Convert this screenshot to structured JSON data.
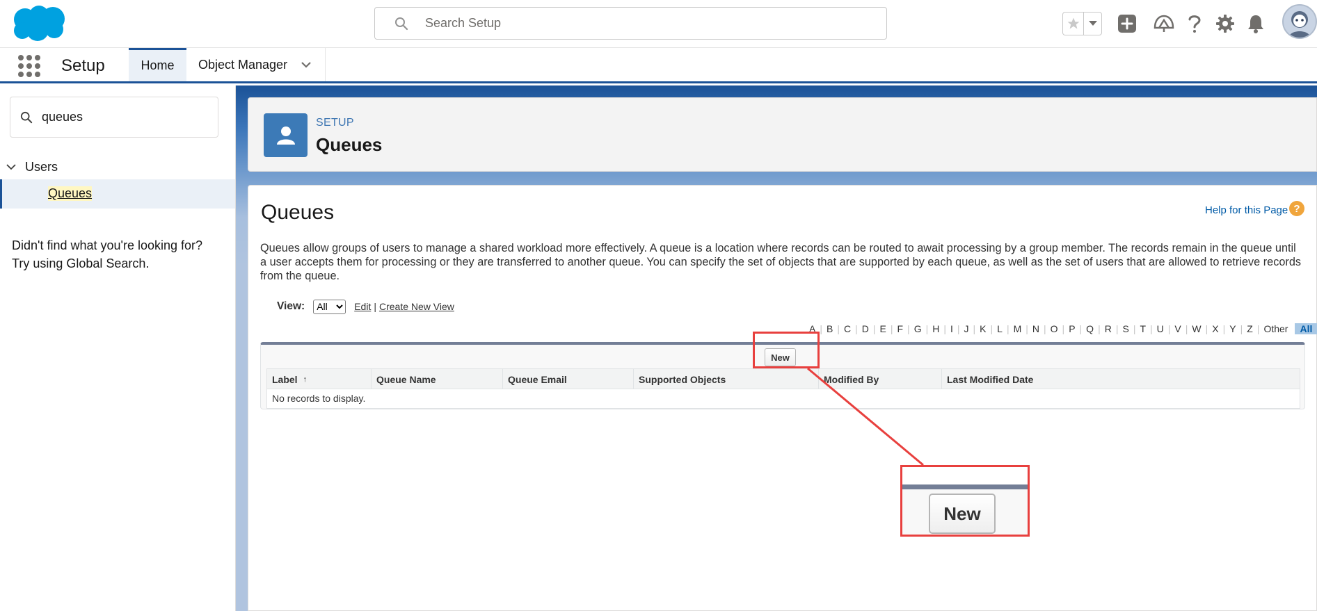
{
  "header": {
    "search_placeholder": "Search Setup",
    "icons": [
      "salesforce-cloud-logo",
      "search-icon",
      "star-icon",
      "chevron-down-icon",
      "add-icon",
      "trailhead-icon",
      "help-icon",
      "gear-icon",
      "bell-icon",
      "avatar"
    ]
  },
  "context_bar": {
    "app_name": "Setup",
    "tabs": [
      {
        "label": "Home",
        "active": true
      },
      {
        "label": "Object Manager",
        "active": false
      }
    ]
  },
  "sidebar": {
    "quickfind_value": "queues",
    "tree": {
      "group_label": "Users",
      "item_label": "Queues"
    },
    "not_found": {
      "line1": "Didn't find what you're looking for?",
      "line2": "Try using Global Search."
    }
  },
  "page_header": {
    "eyebrow": "SETUP",
    "title": "Queues"
  },
  "main": {
    "title": "Queues",
    "help_link": "Help for this Page",
    "help_icon_glyph": "?",
    "description": "Queues allow groups of users to manage a shared workload more effectively. A queue is a location where records can be routed to await processing by a group member. The records remain in the queue until a user accepts them for processing or they are transferred to another queue. You can specify the set of objects that are supported by each queue, as well as the set of users that are allowed to retrieve records from the queue.",
    "view": {
      "label": "View:",
      "selected": "All",
      "edit_link": "Edit",
      "separator": "|",
      "create_link": "Create New View"
    },
    "alpha_filter": [
      "A",
      "B",
      "C",
      "D",
      "E",
      "F",
      "G",
      "H",
      "I",
      "J",
      "K",
      "L",
      "M",
      "N",
      "O",
      "P",
      "Q",
      "R",
      "S",
      "T",
      "U",
      "V",
      "W",
      "X",
      "Y",
      "Z",
      "Other"
    ],
    "alpha_active": "All",
    "new_button": "New",
    "table": {
      "columns": [
        "Label",
        "Queue Name",
        "Queue Email",
        "Supported Objects",
        "Modified By",
        "Last Modified Date"
      ],
      "sort_indicator": "↑",
      "empty_message": "No records to display."
    }
  },
  "annotation": {
    "zoom_label": "New",
    "color": "#e8403e"
  },
  "colors": {
    "brand_blue": "#1b5297",
    "link_blue": "#015ba7",
    "setup_icon_bg": "#3c7ab7",
    "salesforce_cloud": "#00a1e0",
    "highlight_red": "#e8403e"
  }
}
